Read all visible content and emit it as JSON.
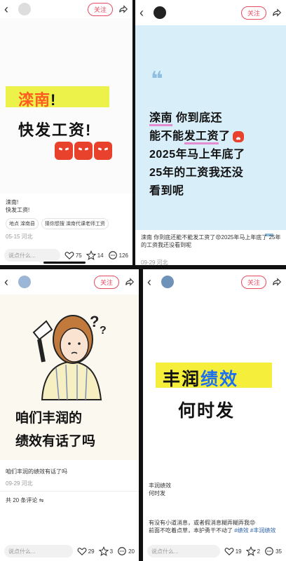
{
  "panels": [
    {
      "user": "",
      "follow": "关注",
      "image": {
        "line1_orange": "滦南",
        "line1_rest": "!",
        "line2": "快发工资!"
      },
      "caption": {
        "line1": "滦南!",
        "line2": "快发工资!"
      },
      "tags": [
        "地点 滦南县",
        "猜你想搜 滦南代课老师工资"
      ],
      "date": "05-15 河北",
      "comment_placeholder": "说点什么...",
      "likes": "75",
      "stars": "14",
      "comments": "126"
    },
    {
      "user": "",
      "follow": "关注",
      "image": {
        "line1a": "滦南",
        "line1b": " 你到底还",
        "line2a": "能不能",
        "line2b": "发工资",
        "line2c": "了",
        "line3": "2025年马上年底了",
        "line4": " 25年的工资我还没",
        "line5": "看到呢"
      },
      "caption": "滦南 你到底还能不能发工资了😡2025年马上年底了 25年的工资我还没看到呢",
      "date": "09-29 河北"
    },
    {
      "user": "",
      "follow": "关注",
      "image": {
        "line1": "咱们丰润的",
        "line2": "绩效有话了吗"
      },
      "caption": "咱们丰润的绩效有话了吗",
      "date": "09-29 河北",
      "comments_total": "共 20 条评论",
      "comment_placeholder": "说点什么...",
      "likes": "29",
      "stars": "3",
      "comments": "20"
    },
    {
      "user": "",
      "follow": "关注",
      "image": {
        "line1a": "丰润",
        "line1b": "绩效",
        "line2": "何时发"
      },
      "caption": {
        "line1": "丰润绩效",
        "line2": "何时发"
      },
      "body_text": "有没有小道消息，或者假消息糊弄糊弄我😡",
      "body_text2": "前面不吃着点草，本护勇干不动了",
      "hashtags": "#绩效 #丰润绩效",
      "comment_placeholder": "说点什么...",
      "likes": "19",
      "stars": "2",
      "comments": "35"
    }
  ],
  "colors": {
    "accent": "#e84a5f",
    "blue_bg": "#d8eef9",
    "yellow": "#ecf24a"
  }
}
